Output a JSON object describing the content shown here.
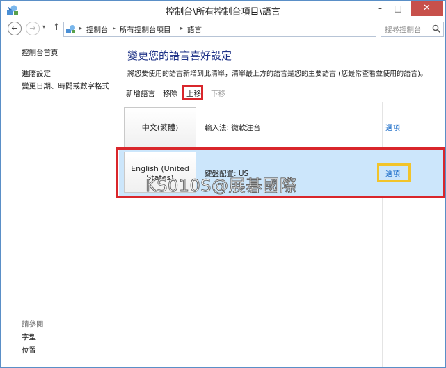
{
  "window": {
    "title": "控制台\\所有控制台項目\\語言",
    "minimize": "–",
    "maximize": "□",
    "close": "✕"
  },
  "nav": {
    "back": "←",
    "forward": "→",
    "recent": "▾",
    "up": "↑",
    "breadcrumbs": [
      "控制台",
      "所有控制台項目",
      "語言"
    ],
    "crumb_separator": "▸",
    "dropdown": "▾",
    "refresh": "↻",
    "search_placeholder": "搜尋控制台"
  },
  "sidebar": {
    "home": "控制台首頁",
    "advanced": "進階設定",
    "change_date": "變更日期、時間或數字格式",
    "see_also": "請參閱",
    "font": "字型",
    "location": "位置"
  },
  "main": {
    "heading": "變更您的語言喜好設定",
    "description": "將您要使用的語言新增到此清單，清單最上方的語言是您的主要語言 (您最常查看並使用的語言)。",
    "toolbar": {
      "add": "新增語言",
      "remove": "移除",
      "move_up": "上移",
      "move_down": "下移"
    },
    "languages": [
      {
        "name": "中文(繁體)",
        "info": "輸入法: 微軟注音",
        "options": "選項"
      },
      {
        "name_line1": "English (United",
        "name_line2": "States)",
        "info": "鍵盤配置: US",
        "options": "選項"
      }
    ]
  },
  "watermark": "KS010S@展碁國際",
  "colors": {
    "heading": "#1e3287",
    "link": "#1d6ec9",
    "selected_row": "#cce6fb",
    "highlight_red": "#d9262b",
    "highlight_yellow": "#f2c42a",
    "close_button": "#c7504b"
  }
}
